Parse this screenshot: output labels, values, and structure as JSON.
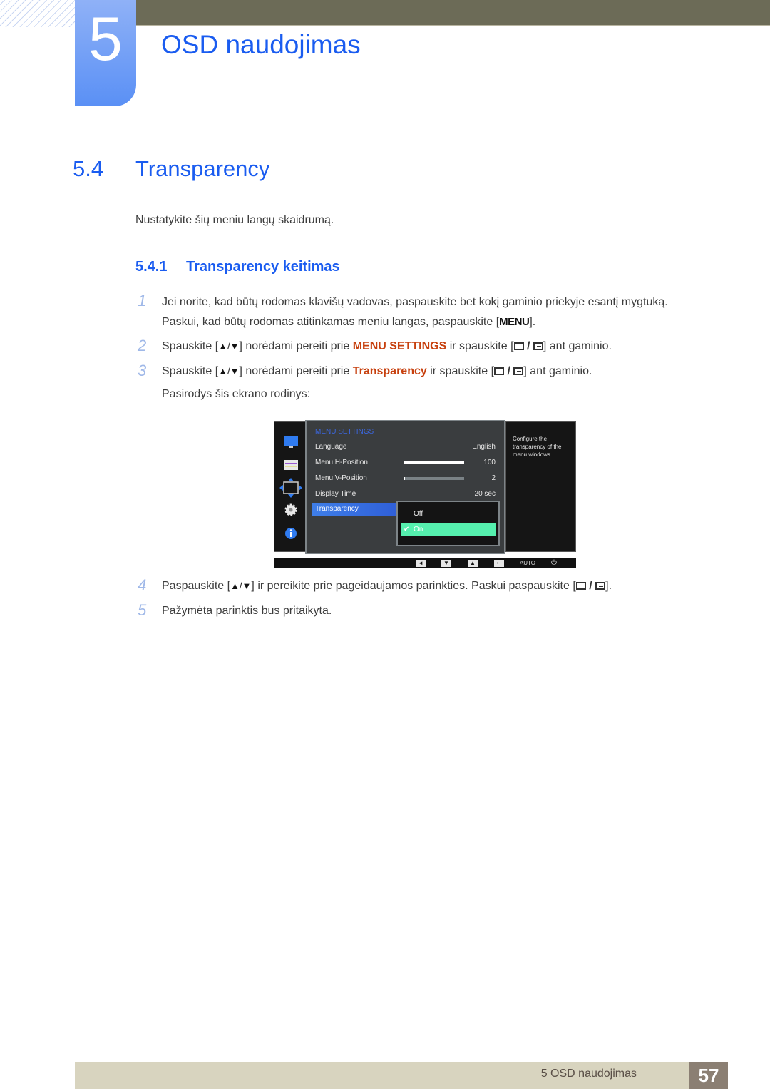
{
  "header": {
    "chapter_number": "5",
    "chapter_title": "OSD naudojimas"
  },
  "section": {
    "number": "5.4",
    "title": "Transparency",
    "intro": "Nustatykite šių meniu langų skaidrumą."
  },
  "subsection": {
    "number": "5.4.1",
    "title": "Transparency keitimas"
  },
  "steps": [
    {
      "n": "1",
      "line1": "Jei norite, kad būtų rodomas klavišų vadovas, paspauskite bet kokį gaminio priekyje esantį mygtuką.",
      "line2_pre": "Paskui, kad būtų rodomas atitinkamas meniu langas, paspauskite [",
      "line2_key": "MENU",
      "line2_post": "]."
    },
    {
      "n": "2",
      "pre": "Spauskite [",
      "arrows": "▲/▼",
      "mid": "] norėdami pereiti prie ",
      "highlight": "MENU SETTINGS",
      "post1": " ir spauskite [",
      "post2": "] ant gaminio."
    },
    {
      "n": "3",
      "pre": "Spauskite [",
      "arrows": "▲/▼",
      "mid": "] norėdami pereiti prie ",
      "highlight": "Transparency",
      "post1": " ir spauskite [",
      "post2": "] ant gaminio.",
      "line2": "Pasirodys šis ekrano rodinys:"
    },
    {
      "n": "4",
      "pre": "Paspauskite [",
      "arrows": "▲/▼",
      "mid": "] ir pereikite prie pageidaujamos parinkties. Paskui paspauskite [",
      "post": "]."
    },
    {
      "n": "5",
      "text": "Pažymėta parinktis bus pritaikyta."
    }
  ],
  "osd": {
    "menu_title": "MENU SETTINGS",
    "rows": [
      {
        "label": "Language",
        "value": "English"
      },
      {
        "label": "Menu H-Position",
        "value": "100",
        "slider_fraction": 1.0
      },
      {
        "label": "Menu V-Position",
        "value": "2",
        "slider_fraction": 0.02
      },
      {
        "label": "Display Time",
        "value": "20 sec"
      },
      {
        "label": "Transparency",
        "value": ""
      }
    ],
    "selected_row": "Transparency",
    "submenu": [
      {
        "label": "Off",
        "selected": false
      },
      {
        "label": "On",
        "selected": true
      }
    ],
    "description": "Configure the transparency of the menu windows.",
    "left_icons": [
      "picture-icon",
      "onscreen-display-icon",
      "position-icon",
      "settings-gear-icon",
      "information-icon"
    ],
    "bottom_buttons": [
      {
        "icon": "left-arrow-icon",
        "glyph": "◄"
      },
      {
        "icon": "down-arrow-icon",
        "glyph": "▼"
      },
      {
        "icon": "up-arrow-icon",
        "glyph": "▲"
      },
      {
        "icon": "enter-icon",
        "glyph": "↵"
      },
      {
        "icon": "auto-label",
        "glyph": "AUTO"
      },
      {
        "icon": "power-icon",
        "glyph": "⏻"
      }
    ],
    "colors": {
      "title": "#3b67e0",
      "selection": "#3e7ee8",
      "submenu_selected": "#55f0ae"
    }
  },
  "footer": {
    "chapter_label": "5 OSD naudojimas",
    "page_number": "57"
  },
  "colors": {
    "heading_blue": "#1a5cf0",
    "highlight_orange": "#c7400e",
    "top_bar": "#6c6b57",
    "footer_bg": "#d8d4bf",
    "page_box": "#8b7f73"
  }
}
